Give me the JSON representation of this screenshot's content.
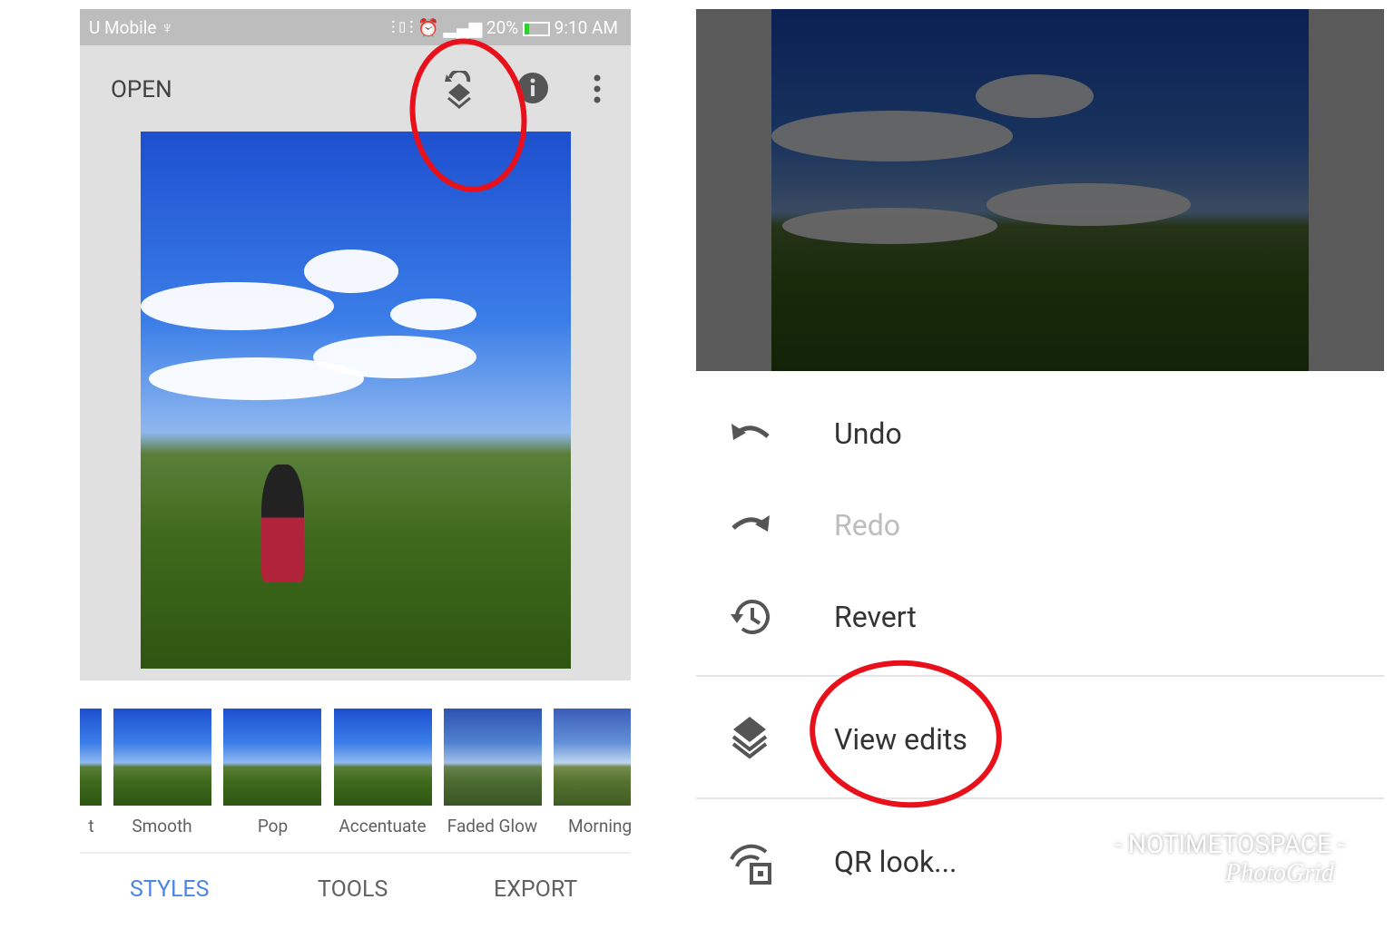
{
  "status_bar": {
    "carrier": "U Mobile ♆",
    "indicators": "⫶▯⫶ ⏰ ▂▄▆ 20%",
    "battery_level_percent": 20,
    "time": "9:10 AM"
  },
  "toolbar": {
    "open_label": "OPEN",
    "icons": [
      "undo-layers-icon",
      "info-icon",
      "more-vert-icon"
    ]
  },
  "styles": [
    {
      "label": "t"
    },
    {
      "label": "Smooth"
    },
    {
      "label": "Pop"
    },
    {
      "label": "Accentuate"
    },
    {
      "label": "Faded Glow"
    },
    {
      "label": "Morning"
    }
  ],
  "tabs": [
    {
      "label": "STYLES",
      "active": true
    },
    {
      "label": "TOOLS"
    },
    {
      "label": "EXPORT"
    }
  ],
  "menu": {
    "items": [
      {
        "label": "Undo",
        "icon": "undo-icon",
        "enabled": true
      },
      {
        "label": "Redo",
        "icon": "redo-icon",
        "enabled": false
      },
      {
        "label": "Revert",
        "icon": "history-icon",
        "enabled": true
      },
      {
        "label": "View edits",
        "icon": "layers-icon",
        "enabled": true
      },
      {
        "label": "QR look...",
        "icon": "qr-look-icon",
        "enabled": true
      }
    ]
  },
  "watermark": {
    "line1": "- NOTIMETOSPACE -",
    "line2": "PhotoGrid"
  },
  "colors": {
    "accent": "#4a86e8",
    "annotation": "#e8101a",
    "disabled": "#bdbdbd"
  }
}
